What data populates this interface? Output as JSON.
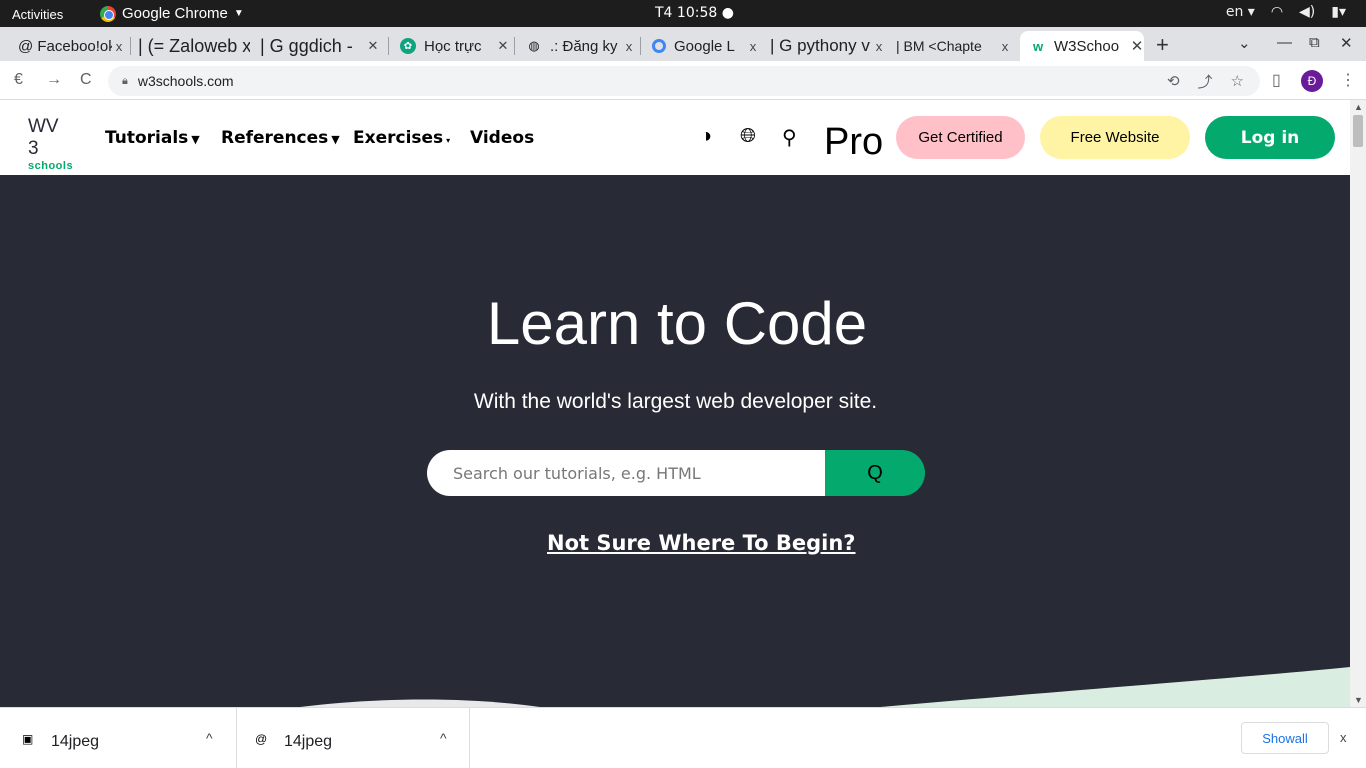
{
  "system_bar": {
    "activities": "Activities",
    "app_name": "Google Chrome",
    "clock": "T4 10:58 ●",
    "language": "en ▾"
  },
  "tabs": [
    {
      "title": "@ Faceboo!ok",
      "favicon": "facebook-icon"
    },
    {
      "title": "| (= Zaloweb x",
      "favicon": "zalo-icon"
    },
    {
      "title": "| G ggdich -",
      "favicon": "google-icon"
    },
    {
      "title": "Học trực",
      "favicon": "chatgpt-icon"
    },
    {
      "title": ".: Đăng ky",
      "favicon": "globe-icon"
    },
    {
      "title": "Google L",
      "favicon": "google-lens-icon"
    },
    {
      "title": "| G pythony v",
      "favicon": "google-icon"
    },
    {
      "title": "| BM <Chapte",
      "favicon": "document-icon"
    },
    {
      "title": "W3Schoo",
      "favicon": "w3schools-icon"
    }
  ],
  "address": {
    "back": "€",
    "forward": "→",
    "reload": "C",
    "url": "w3schools.com"
  },
  "profile_initial": "Đ",
  "w3": {
    "logo_big": "WV 3",
    "logo_small": "schools",
    "nav": {
      "tutorials": "Tutorials",
      "references": "References",
      "exercises": "Exercises",
      "videos": "Videos"
    },
    "pro": "Pro",
    "get_certified": "Get Certified",
    "free_website": "Free Website",
    "login": "Log in"
  },
  "hero": {
    "title": "Learn to Code",
    "subtitle": "With the world's largest web developer site.",
    "search_placeholder": "Search our tutorials, e.g. HTML",
    "search_button": "Q",
    "link": "Not Sure Where To Begin?"
  },
  "downloads": {
    "items": [
      {
        "name": "14jpeg",
        "icon": "image-file-icon"
      },
      {
        "name": "14jpeg",
        "icon": "image-file-icon"
      }
    ],
    "show_all": "Showall",
    "close": "x"
  },
  "colors": {
    "w3_green": "#04aa6d",
    "hero_bg": "#282a35",
    "pink": "#ffc0c7",
    "yellow": "#fff4a3"
  }
}
